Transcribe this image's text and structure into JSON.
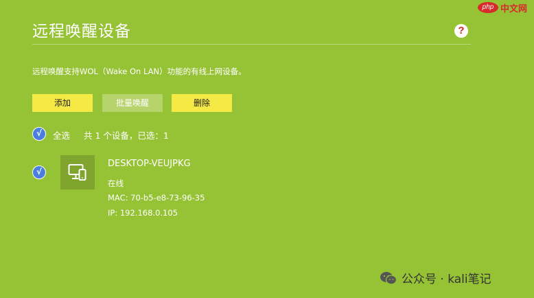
{
  "page": {
    "title": "远程唤醒设备",
    "description": "远程唤醒支持WOL（Wake On LAN）功能的有线上网设备。"
  },
  "header": {
    "help_icon": "question-icon",
    "help_glyph": "?"
  },
  "toolbar": {
    "add_label": "添加",
    "batch_wake_label": "批量唤醒",
    "delete_label": "删除"
  },
  "selection": {
    "select_all_label": "全选",
    "count_text": "共 1 个设备，已选：1",
    "check_glyph": "√"
  },
  "devices": [
    {
      "name": "DESKTOP-VEUJPKG",
      "status": "在线",
      "mac": "MAC: 70-b5-e8-73-96-35",
      "ip": "IP: 192.168.0.105",
      "icon": "desktop-phone-icon",
      "selected": true
    }
  ],
  "branding": {
    "php_badge": "php",
    "php_site": "中文网",
    "watermark": "公众号 · kali笔记"
  },
  "colors": {
    "background": "#96c236",
    "button_yellow": "#f5ea45",
    "button_disabled": "#b6d36c",
    "check_blue": "#4a7fe0",
    "help_red": "#d3271f"
  }
}
